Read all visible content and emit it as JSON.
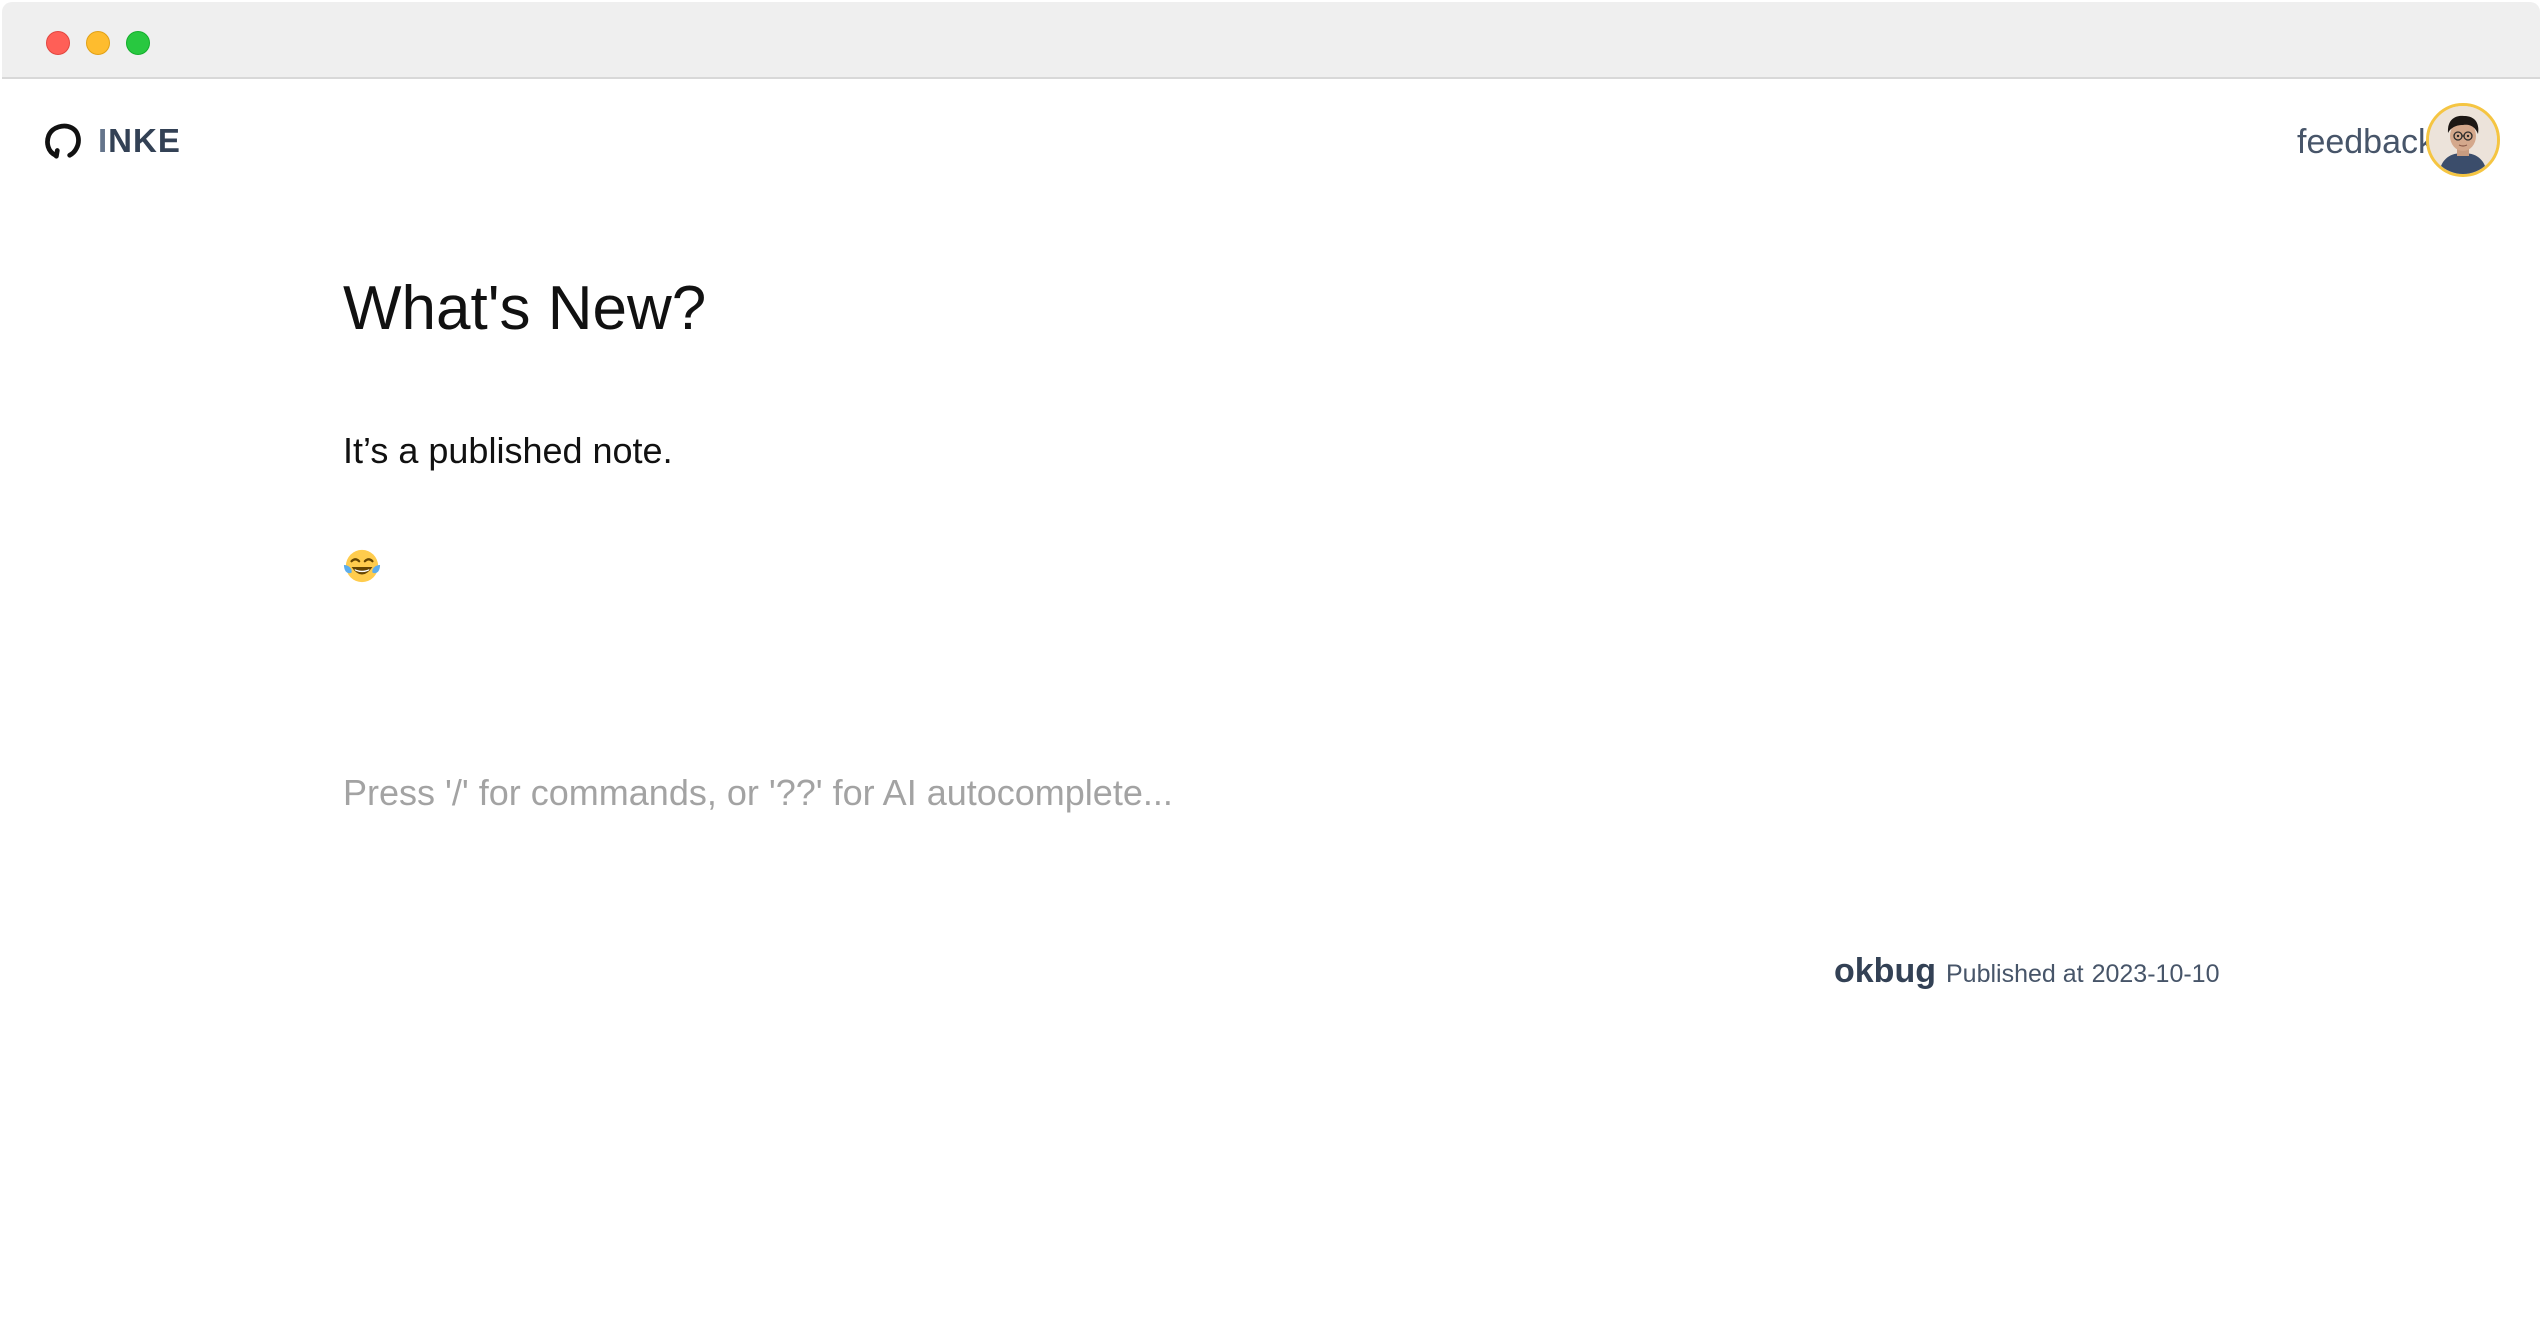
{
  "window": {
    "controls": [
      "close",
      "minimize",
      "zoom"
    ]
  },
  "header": {
    "brand": {
      "icon": "logo-ring-icon",
      "initial": "I",
      "rest": "NKE"
    },
    "feedback_label": "feedback",
    "avatar": {
      "alt": "user avatar",
      "border_color": "#f5c542"
    }
  },
  "note": {
    "title": "What's New?",
    "paragraph": "It’s a published note.",
    "emoji": "face-with-tears-of-joy",
    "editor_placeholder": "Press '/' for commands, or '??' for AI autocomplete..."
  },
  "meta": {
    "author": "okbug",
    "published_label": "Published at",
    "published_date": "2023-10-10"
  },
  "colors": {
    "titlebar": "#efefef",
    "text": "#111111",
    "muted": "#475569",
    "placeholder": "#a3a3a3"
  }
}
